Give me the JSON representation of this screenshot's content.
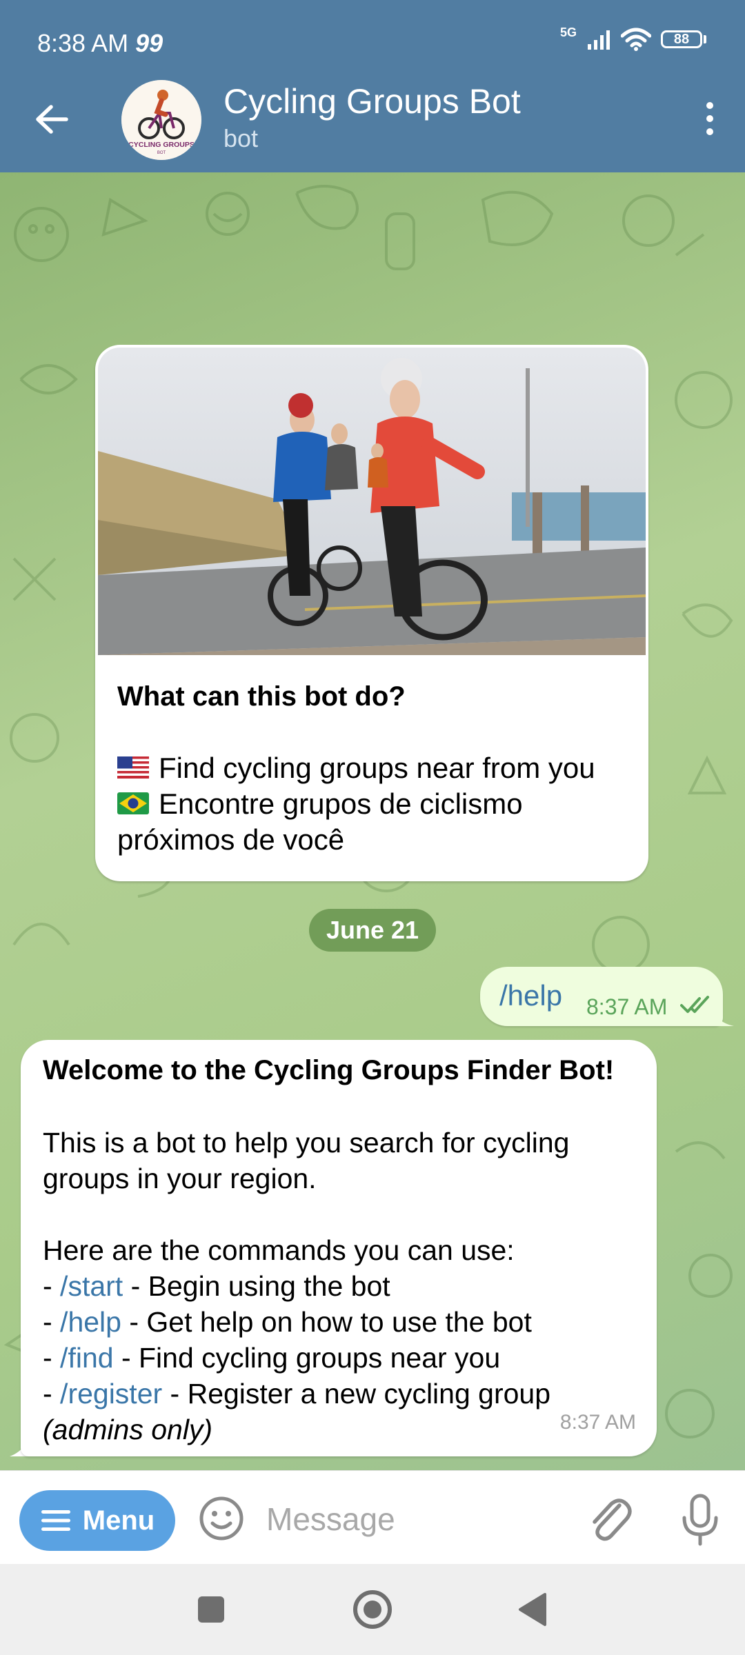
{
  "status_bar": {
    "time": "8:38 AM",
    "notification": "99",
    "network": "5G",
    "battery": "88"
  },
  "header": {
    "title": "Cycling Groups Bot",
    "subtitle": "bot",
    "avatar_text": "CYCLING GROUPS",
    "avatar_subtext": "BOT"
  },
  "intro_card": {
    "heading": "What can this bot do?",
    "lines": [
      "Find cycling groups near from you",
      "Encontre grupos de ciclismo",
      "próximos de você"
    ]
  },
  "date_separator": "June 21",
  "outgoing_message": {
    "text": "/help",
    "time": "8:37 AM"
  },
  "incoming_message": {
    "title": "Welcome to the Cycling Groups Finder Bot!",
    "intro_1": "This is a bot to help you search for cycling",
    "intro_2": "groups in your region.",
    "commands_heading": "Here are the commands you can use:",
    "commands": [
      {
        "cmd": "/start",
        "desc": " - Begin using the bot"
      },
      {
        "cmd": "/help",
        "desc": " - Get help on how to use the bot"
      },
      {
        "cmd": "/find",
        "desc": " - Find cycling groups near you"
      },
      {
        "cmd": "/register",
        "desc": " - Register a new cycling group"
      }
    ],
    "note": "(admins only)",
    "time": "8:37 AM"
  },
  "input_bar": {
    "menu_label": "Menu",
    "placeholder": "Message"
  },
  "colors": {
    "header_bg": "#517da2",
    "link": "#3a76a8",
    "menu_button": "#5aa2e2",
    "outgoing_bubble": "#effdde"
  },
  "icons": [
    "back-arrow-icon",
    "more-vert-icon",
    "hamburger-icon",
    "emoji-icon",
    "paperclip-icon",
    "mic-icon",
    "double-check-icon",
    "nav-recents-icon",
    "nav-home-icon",
    "nav-back-icon"
  ]
}
